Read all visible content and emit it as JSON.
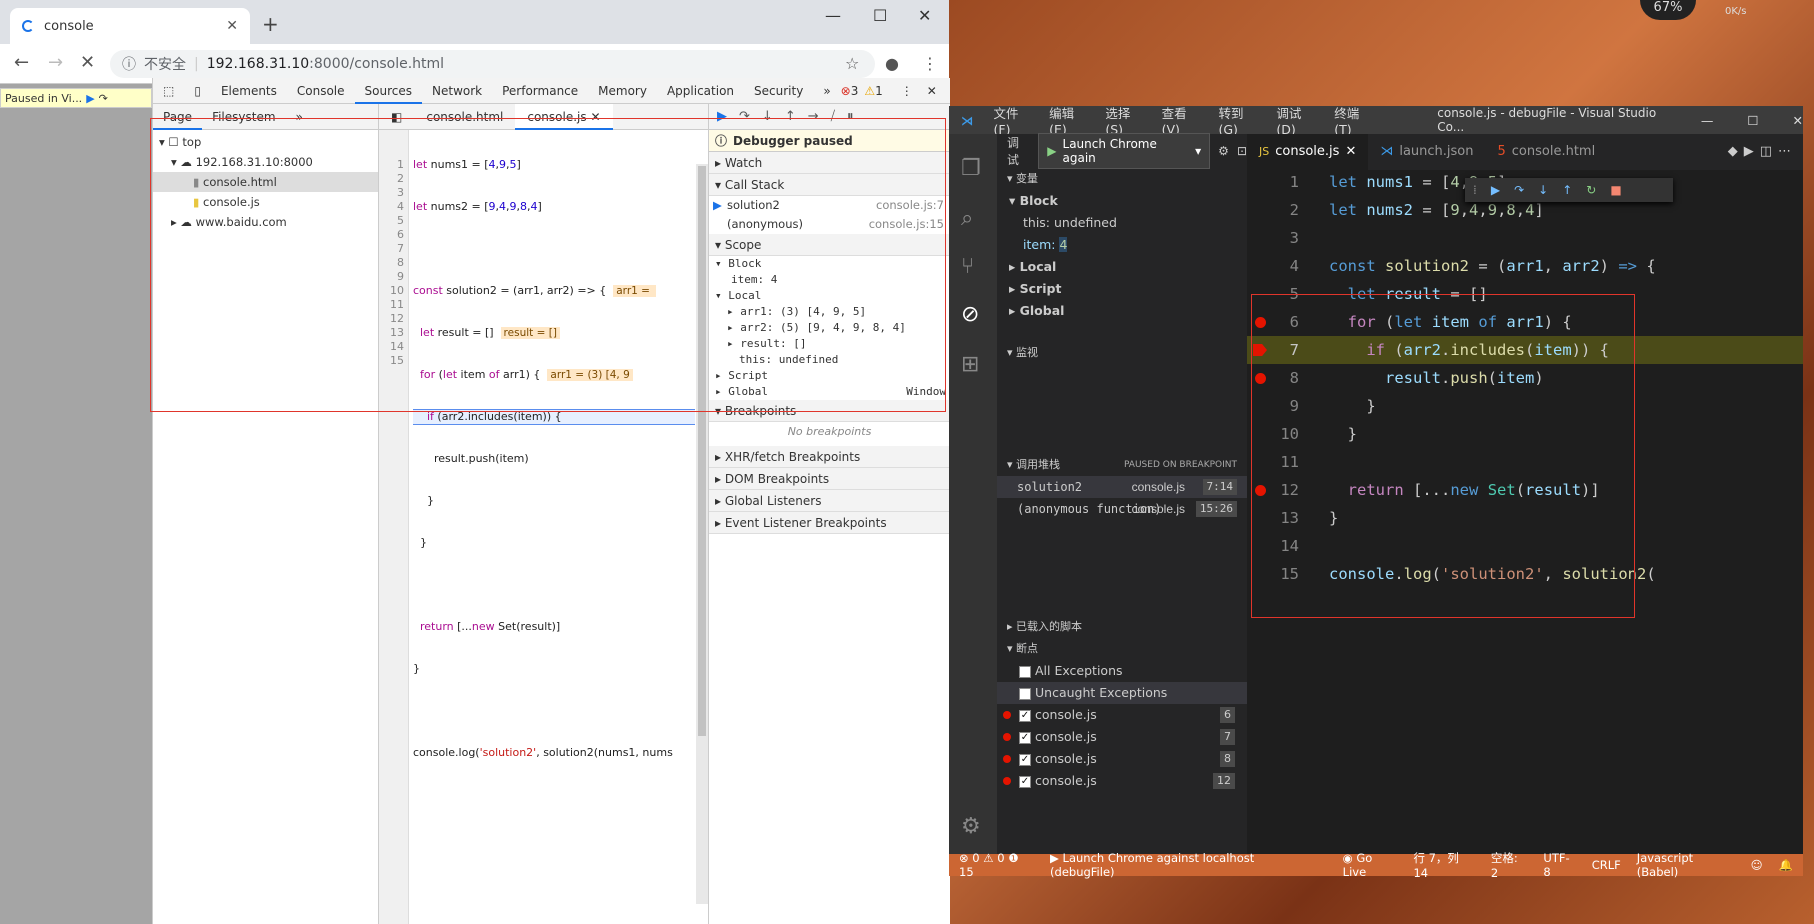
{
  "browser": {
    "tab_title": "console",
    "url_security": "不安全",
    "url_host": "192.168.31.10",
    "url_rest": ":8000/console.html"
  },
  "page": {
    "paused_text": "Paused in Vi..."
  },
  "devtools": {
    "tabs": [
      "Elements",
      "Console",
      "Sources",
      "Network",
      "Performance",
      "Memory",
      "Application",
      "Security"
    ],
    "error_count": "3",
    "warn_count": "1",
    "nav_tabs": [
      "Page",
      "Filesystem"
    ],
    "tree": {
      "top": "top",
      "host": "192.168.31.10:8000",
      "file1": "console.html",
      "file2": "console.js",
      "other": "www.baidu.com"
    },
    "editor_tabs": [
      "console.html",
      "console.js"
    ],
    "debugger_paused": "Debugger paused",
    "sections": {
      "watch": "Watch",
      "callstack": "Call Stack",
      "scope": "Scope",
      "breakpoints": "Breakpoints",
      "xhr": "XHR/fetch Breakpoints",
      "dom": "DOM Breakpoints",
      "global": "Global Listeners",
      "event": "Event Listener Breakpoints"
    },
    "callstack": [
      {
        "fn": "solution2",
        "loc": "console.js:7"
      },
      {
        "fn": "(anonymous)",
        "loc": "console.js:15"
      }
    ],
    "scope": {
      "block": "Block",
      "block_item": "item: 4",
      "local": "Local",
      "arr1": "arr1: (3) [4, 9, 5]",
      "arr2": "arr2: (5) [9, 4, 9, 8, 4]",
      "result": "result: []",
      "this": "this: undefined",
      "script": "Script",
      "global": "Global",
      "window": "Window"
    },
    "no_breakpoints": "No breakpoints"
  },
  "vscode": {
    "menus": [
      "文件(F)",
      "编辑(E)",
      "选择(S)",
      "查看(V)",
      "转到(G)",
      "调试(D)",
      "终端(T)"
    ],
    "window_title": "console.js - debugFile - Visual Studio Co...",
    "debug_label": "调试",
    "launch_config": "Launch Chrome again",
    "tabs": [
      "console.js",
      "launch.json",
      "console.html"
    ],
    "variables_title": "变量",
    "block": "Block",
    "this_row": "this: undefined",
    "item_key": "item:",
    "item_val": "4",
    "local": "Local",
    "script": "Script",
    "global": "Global",
    "watch_title": "监视",
    "callstack_title": "调用堆栈",
    "callstack_status": "PAUSED ON BREAKPOINT",
    "stack": [
      {
        "fn": "solution2",
        "file": "console.js",
        "pos": "7:14"
      },
      {
        "fn": "(anonymous function)",
        "file": "console.js",
        "pos": "15:26"
      }
    ],
    "loaded_scripts": "已载入的脚本",
    "breakpoints_title": "断点",
    "all_exceptions": "All Exceptions",
    "uncaught_exceptions": "Uncaught Exceptions",
    "bps": [
      {
        "file": "console.js",
        "line": "6"
      },
      {
        "file": "console.js",
        "line": "7"
      },
      {
        "file": "console.js",
        "line": "8"
      },
      {
        "file": "console.js",
        "line": "12"
      }
    ],
    "status": {
      "counts": "⊗ 0 ⚠ 0 ❶ 15",
      "launch": "Launch Chrome against localhost (debugFile)",
      "golive": "Go Live",
      "pos": "行 7，列 14",
      "spaces": "空格: 2",
      "enc": "UTF-8",
      "eol": "CRLF",
      "lang": "Javascript (Babel)"
    }
  },
  "colors": {
    "accent": "#1a73e8",
    "status_bar": "#cc6633",
    "breakpoint": "#e51400",
    "highlight": "#e0352b"
  },
  "net": {
    "percent": "67%",
    "speed": "0K/s"
  }
}
